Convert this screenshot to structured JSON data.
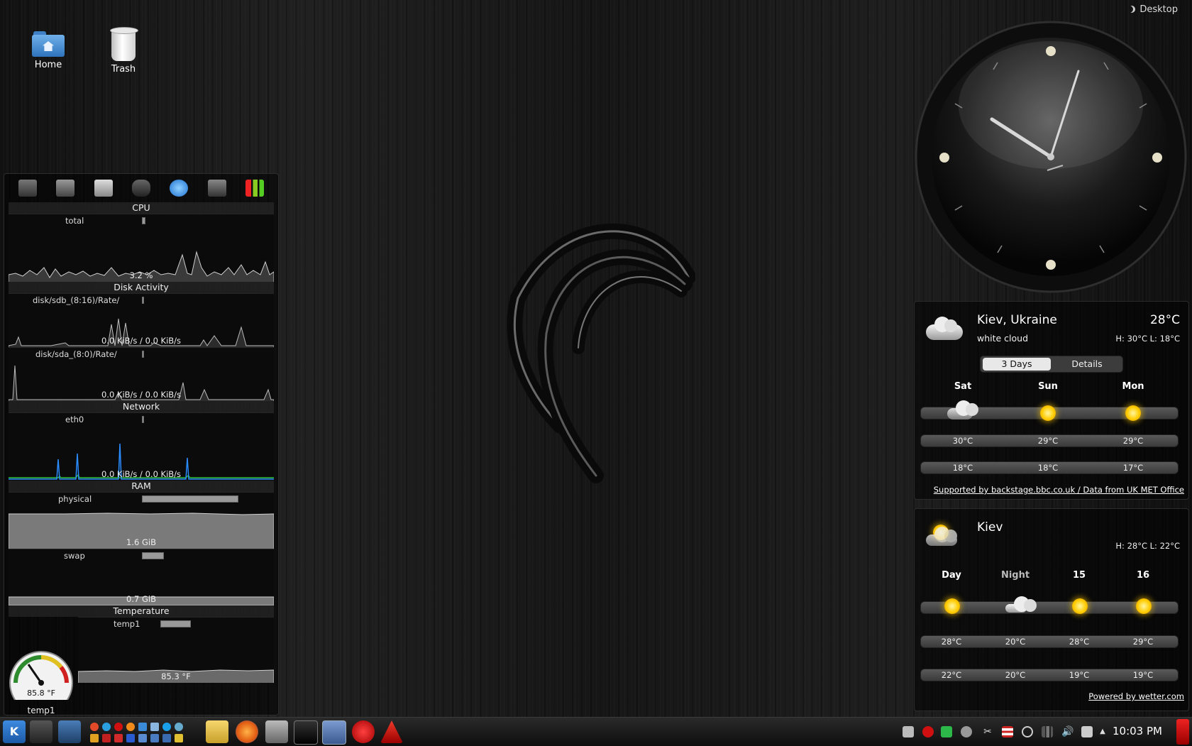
{
  "desktop_toolbox": {
    "label": "Desktop"
  },
  "desktop_icons": [
    {
      "label": "Home",
      "icon": "home-folder-icon"
    },
    {
      "label": "Trash",
      "icon": "trash-icon"
    }
  ],
  "sysmon": {
    "cpu": {
      "title": "CPU",
      "sensor": "total",
      "value": "3.2 %",
      "level": 0.03
    },
    "disk": {
      "title": "Disk Activity",
      "sdb": {
        "label": "disk/sdb_(8:16)/Rate/",
        "value": "0.0 KiB/s / 0.0 KiB/s"
      },
      "sda": {
        "label": "disk/sda_(8:0)/Rate/",
        "value": "0.0 KiB/s / 0.0 KiB/s"
      }
    },
    "network": {
      "title": "Network",
      "sensor": "eth0",
      "value": "0.0 KiB/s / 0.0 KiB/s"
    },
    "ram": {
      "title": "RAM",
      "physical": {
        "label": "physical",
        "value": "1.6 GiB",
        "level": 0.92
      },
      "swap": {
        "label": "swap",
        "value": "0.7 GiB",
        "level": 0.2
      }
    },
    "temperature": {
      "title": "Temperature",
      "sensor": "temp1",
      "value": "85.3 °F",
      "level": 0.28,
      "gauge": {
        "value": "85.8 °F",
        "label": "temp1"
      }
    }
  },
  "weather_bbc": {
    "city": "Kiev, Ukraine",
    "condition": "white cloud",
    "temp": "28°C",
    "hilo": "H: 30°C  L: 18°C",
    "tabs": [
      "3 Days",
      "Details"
    ],
    "days": [
      {
        "name": "Sat",
        "icon": "storm-cloud-icon",
        "high": "30°C",
        "low": "18°C"
      },
      {
        "name": "Sun",
        "icon": "sun-icon",
        "high": "29°C",
        "low": "18°C"
      },
      {
        "name": "Mon",
        "icon": "sun-icon",
        "high": "29°C",
        "low": "17°C"
      }
    ],
    "credit": "Supported by backstage.bbc.co.uk / Data from UK MET Office"
  },
  "weather_wetter": {
    "city": "Kiev",
    "hilo": "H: 28°C  L: 22°C",
    "columns": [
      {
        "name": "Day",
        "icon": "sun-cloud-icon",
        "high": "28°C",
        "low": "22°C"
      },
      {
        "name": "Night",
        "icon": "night-cloud-icon",
        "high": "20°C",
        "low": "20°C"
      },
      {
        "name": "15",
        "icon": "sun-cloud-icon",
        "high": "28°C",
        "low": "19°C"
      },
      {
        "name": "16",
        "icon": "sun-cloud-icon",
        "high": "29°C",
        "low": "19°C"
      }
    ],
    "credit": "Powered by wetter.com"
  },
  "clock": {
    "time": "10:03 PM"
  },
  "taskbar": {
    "time": "10:03 PM"
  },
  "colors": {
    "accent_red": "#c81e1e",
    "net_blue": "#2a8cff",
    "net_green": "#2fbf3a"
  }
}
